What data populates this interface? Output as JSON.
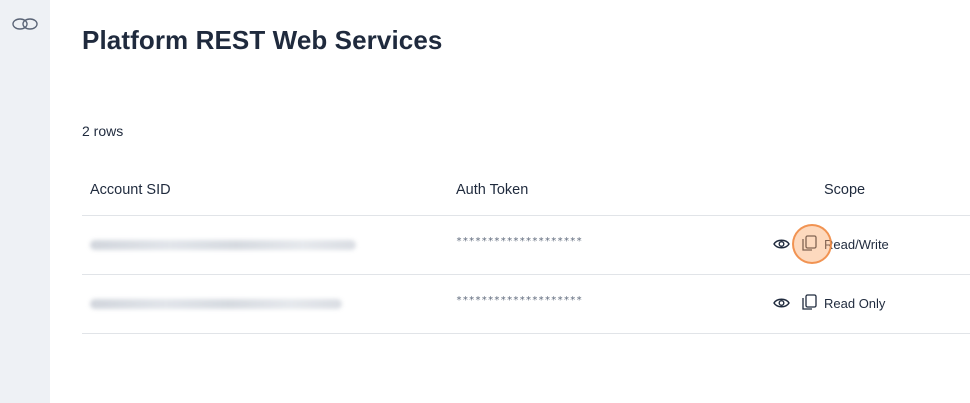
{
  "page": {
    "title": "Platform REST Web Services",
    "row_count": "2 rows"
  },
  "table": {
    "columns": [
      "Account SID",
      "Auth Token",
      "Scope"
    ],
    "rows": [
      {
        "account_sid": "",
        "auth_token": "********************",
        "scope": "Read/Write"
      },
      {
        "account_sid": "",
        "auth_token": "********************",
        "scope": "Read Only"
      }
    ]
  },
  "icons": {
    "sidebar": "link-icon",
    "reveal": "eye-icon",
    "copy": "copy-icon"
  },
  "colors": {
    "sidebar_bg": "#eef1f5",
    "text": "#1f2a3d",
    "divider": "#e1e4e8",
    "cursor_highlight": "#f08c46"
  }
}
